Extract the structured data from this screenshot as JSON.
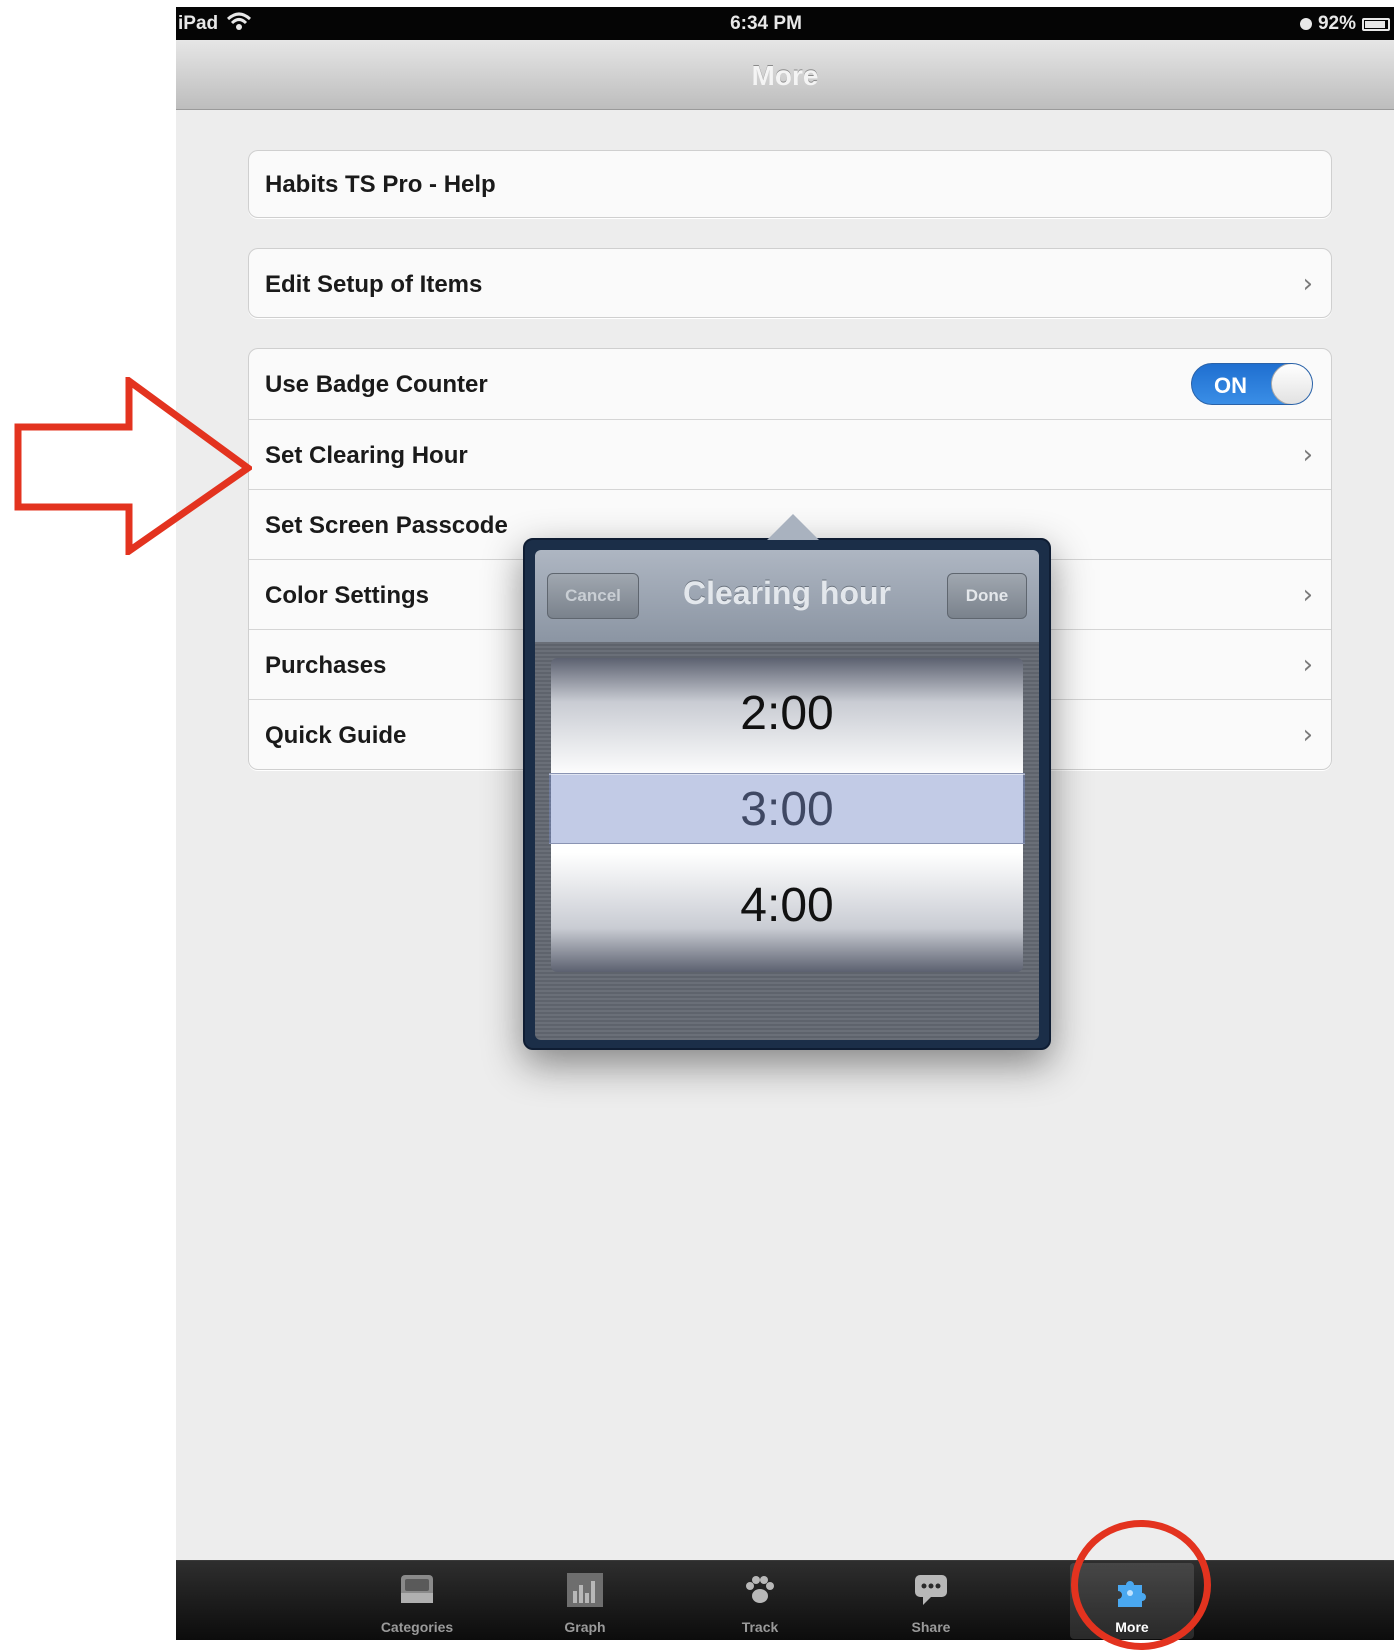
{
  "status_bar": {
    "carrier": "iPad",
    "time": "6:34 PM",
    "battery": "92%",
    "battery_level": 0.92
  },
  "nav_bar": {
    "title": "More"
  },
  "groups": {
    "help": {
      "label": "Habits TS Pro - Help"
    },
    "edit_setup": {
      "label": "Edit Setup of Items"
    },
    "settings": {
      "badge_counter": {
        "label": "Use Badge Counter",
        "toggle": "ON"
      },
      "clearing_hour": {
        "label": "Set Clearing Hour"
      },
      "passcode": {
        "label": "Set Screen Passcode"
      },
      "color": {
        "label": "Color Settings"
      },
      "purchases": {
        "label": "Purchases"
      },
      "quick_guide": {
        "label": "Quick Guide"
      }
    }
  },
  "popover": {
    "title": "Clearing hour",
    "cancel": "Cancel",
    "done": "Done",
    "picker": [
      "2:00",
      "3:00",
      "4:00"
    ],
    "selected": "3:00"
  },
  "tab_bar": {
    "tabs": [
      {
        "label": "Categories",
        "icon": "inbox-tray-icon"
      },
      {
        "label": "Graph",
        "icon": "bar-graph-icon"
      },
      {
        "label": "Track",
        "icon": "paw-print-icon"
      },
      {
        "label": "Share",
        "icon": "speech-bubble-icon"
      },
      {
        "label": "More",
        "icon": "puzzle-piece-icon"
      }
    ],
    "selected": "More"
  },
  "colors": {
    "toggle_on": "#2f80dd",
    "annotation_red": "#e3331f",
    "nav_gradient_top": "#e6e6e6",
    "background": "#ededed"
  }
}
